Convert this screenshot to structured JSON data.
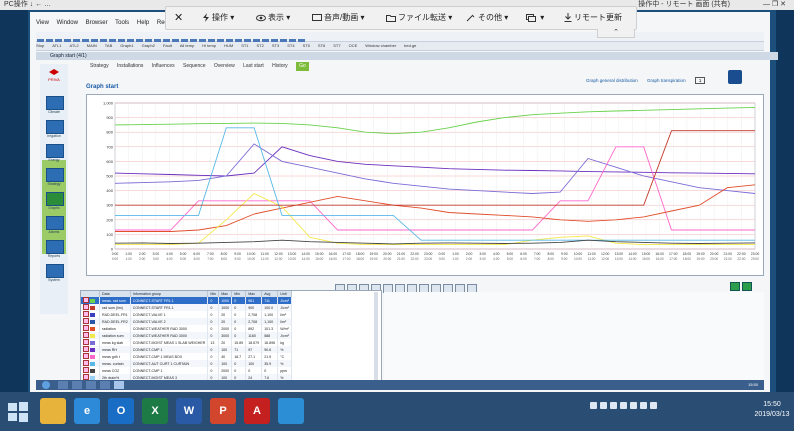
{
  "photo_top": {
    "left_text": "PC操作 ↓ ← …",
    "right_text": "操作中 - リモート 画面 (共有)",
    "right_text2": "— ❐ ✕"
  },
  "remote_toolbar": {
    "close": "✕",
    "items": [
      {
        "label": "操作",
        "icon": "lightning-icon"
      },
      {
        "label": "表示",
        "icon": "eye-icon"
      },
      {
        "label": "音声/動画",
        "icon": "chat-icon"
      },
      {
        "label": "ファイル転送",
        "icon": "folder-icon"
      },
      {
        "label": "その他",
        "icon": "tools-icon"
      },
      {
        "label": "",
        "icon": "windows-icon"
      },
      {
        "label": "リモート更新",
        "icon": "download-icon"
      }
    ],
    "collapse_label": "⌃"
  },
  "app_menu": [
    "View",
    "Window",
    "Browser",
    "Tools",
    "Help",
    "Registration"
  ],
  "toolbar2_items": [
    "Stop",
    "ATL1",
    "ATL2",
    "MAIN",
    "TAB",
    "Graph1",
    "Graph2",
    "Fault",
    "All temp",
    "Hl temp",
    "HUM",
    "ST1",
    "ST2",
    "ST3",
    "ST4",
    "ST5",
    "ST6",
    "ST7",
    "OCE",
    "Window chamber",
    "bed.ge"
  ],
  "app_title": "Graph start (4/1)",
  "nav_tabs": [
    "Strategy",
    "Installations",
    "Influences",
    "Sequence",
    "Overview",
    "Last start",
    "History"
  ],
  "nav_go": "Go",
  "sidebar": {
    "logo_text": "PRIVA",
    "items": [
      {
        "label": "Climate",
        "active": false
      },
      {
        "label": "Irrigation",
        "active": false
      },
      {
        "label": "Energy",
        "active": false
      },
      {
        "label": "Strategy",
        "active": false
      },
      {
        "label": "Graphs",
        "active": true
      },
      {
        "label": "Alarms",
        "active": false
      },
      {
        "label": "Reports",
        "active": false
      },
      {
        "label": "System",
        "active": false
      }
    ]
  },
  "graph": {
    "title": "Graph start",
    "links": [
      "Graph general distribution",
      "Graph transpiration"
    ],
    "period": "1"
  },
  "chart_data": {
    "type": "line",
    "title": "",
    "xlabel": "",
    "ylabel": "",
    "ylim": [
      0,
      1000
    ],
    "y_ticks": [
      "1,000",
      "900",
      "800",
      "700",
      "600",
      "500",
      "400",
      "300",
      "200",
      "100",
      "0"
    ],
    "x_ticks": [
      "0:00",
      "1:00",
      "2:00",
      "3:00",
      "4:00",
      "5:00",
      "6:00",
      "7:00",
      "8:00",
      "9:00",
      "10:00",
      "11:00",
      "12:00",
      "13:00",
      "14:00",
      "15:00",
      "16:00",
      "17:00",
      "18:00",
      "19:00",
      "20:00",
      "21:00",
      "22:00",
      "23:00",
      "0:00",
      "1:00",
      "2:00",
      "3:00",
      "4:00",
      "5:00",
      "6:00",
      "7:00",
      "8:00",
      "9:00",
      "10:00",
      "11:00",
      "12:00",
      "13:00",
      "14:00",
      "15:00",
      "16:00",
      "17:00",
      "18:00",
      "19:00",
      "20:00",
      "21:00",
      "22:00",
      "23:00"
    ],
    "grid": true,
    "series": [
      {
        "color": "#69d24a",
        "values": [
          850,
          852,
          855,
          858,
          860,
          862,
          860,
          850,
          830,
          800,
          790,
          800,
          830,
          870,
          900,
          920,
          930,
          940,
          945,
          950,
          955,
          960,
          965,
          970
        ]
      },
      {
        "color": "#6a2fbf",
        "values": [
          520,
          515,
          510,
          505,
          500,
          520,
          700,
          640,
          600,
          580,
          570,
          560,
          550,
          545,
          540,
          538,
          535,
          530,
          528,
          525,
          522,
          520,
          518,
          515
        ]
      },
      {
        "color": "#7b6bd6",
        "values": [
          450,
          455,
          460,
          470,
          500,
          720,
          600,
          560,
          520,
          480,
          450,
          430,
          410,
          400,
          390,
          380,
          390,
          620,
          560,
          500,
          460,
          420,
          400,
          380
        ]
      },
      {
        "color": "#ff66cc",
        "values": [
          130,
          130,
          130,
          330,
          330,
          330,
          330,
          330,
          130,
          130,
          130,
          130,
          130,
          130,
          130,
          130,
          330,
          330,
          700,
          700,
          130,
          130,
          130,
          130
        ]
      },
      {
        "color": "#e04e2a",
        "values": [
          120,
          120,
          120,
          130,
          160,
          240,
          280,
          320,
          360,
          330,
          300,
          280,
          250,
          240,
          230,
          220,
          200,
          190,
          200,
          220,
          260,
          300,
          420,
          440
        ]
      },
      {
        "color": "#f3e84a",
        "values": [
          30,
          30,
          30,
          40,
          200,
          380,
          290,
          80,
          40,
          30,
          30,
          30,
          30,
          30,
          30,
          60,
          80,
          90,
          40,
          30,
          30,
          30,
          30,
          30
        ]
      },
      {
        "color": "#57b8e6",
        "values": [
          230,
          230,
          230,
          230,
          830,
          830,
          230,
          230,
          230,
          230,
          230,
          60,
          60,
          60,
          60,
          60,
          60,
          60,
          60,
          60,
          60,
          60,
          60,
          60
        ]
      },
      {
        "color": "#c0392b",
        "values": [
          300,
          300,
          300,
          300,
          300,
          300,
          300,
          300,
          300,
          300,
          300,
          300,
          300,
          300,
          300,
          300,
          300,
          300,
          300,
          300,
          810,
          810,
          810,
          810
        ]
      },
      {
        "color": "#444444",
        "values": [
          40,
          42,
          38,
          40,
          45,
          50,
          60,
          50,
          45,
          40,
          35,
          40,
          42,
          40,
          38,
          40,
          45,
          60,
          50,
          45,
          40,
          38,
          40,
          42
        ]
      }
    ]
  },
  "table": {
    "columns": [
      "Data",
      "Information group",
      "Min",
      "Max",
      "Min",
      "Max",
      "Avg",
      "Unit"
    ],
    "rows": [
      {
        "color": "#69d24a",
        "data": "meas. rad sum",
        "group": "CONNECT-START FR1.1",
        "min": "0",
        "max": "1000",
        "min2": "0",
        "max2": "961",
        "avg": "711",
        "unit": "J/cm²",
        "selected": true
      },
      {
        "color": "#c0392b",
        "data": "rad sum (lim)",
        "group": "CONNECT-START FR1.1",
        "min": "0",
        "max": "1000",
        "min2": "0",
        "max2": "900",
        "avg": "100.0",
        "unit": "J/cm²",
        "selected": false
      },
      {
        "color": "#3a3fbf",
        "data": "RAD.DEEL.FR1",
        "group": "CONNECT-VALVE 1",
        "min": "0",
        "max": "20",
        "min2": "0",
        "max2": "2,708",
        "avg": "1,100",
        "unit": "l/m²",
        "selected": false
      },
      {
        "color": "#2a57a7",
        "data": "RAD.DEEL.FR2",
        "group": "CONNECT-VALVE 2",
        "min": "0",
        "max": "20",
        "min2": "0",
        "max2": "2,708",
        "avg": "1,100",
        "unit": "l/m²",
        "selected": false
      },
      {
        "color": "#e04e2a",
        "data": "radiation",
        "group": "CONNECT-WEATHER RAD 3000",
        "min": "0",
        "max": "2000",
        "min2": "0",
        "max2": "892",
        "avg": "101.3",
        "unit": "W/m²",
        "selected": false
      },
      {
        "color": "#f3e84a",
        "data": "radiation sum",
        "group": "CONNECT-WEATHER RAD 3000",
        "min": "0",
        "max": "3000",
        "min2": "0",
        "max2": "1160",
        "avg": "588",
        "unit": "J/cm²",
        "selected": false
      },
      {
        "color": "#7b6bd6",
        "data": "meas kg slab",
        "group": "CONNECT-MOIST MEAS 1 SLAB WEIGHER",
        "min": "13",
        "max": "20",
        "min2": "15.89",
        "max2": "18.679",
        "avg": "16.896",
        "unit": "kg",
        "selected": false
      },
      {
        "color": "#6a2fbf",
        "data": "meas RH",
        "group": "CONNECT-CMP 1",
        "min": "0",
        "max": "100",
        "min2": "71",
        "max2": "97",
        "avg": "90.6",
        "unit": "%",
        "selected": false
      },
      {
        "color": "#ff66cc",
        "data": "meas gdh t",
        "group": "CONNECT-CMP 1 MEAS BOX",
        "min": "0",
        "max": "40",
        "min2": "18.7",
        "max2": "27.1",
        "avg": "21.9",
        "unit": "°C",
        "selected": false
      },
      {
        "color": "#57b8e6",
        "data": "meas. curtain",
        "group": "CONNECT-AUT CURT 1 CURTAIN",
        "min": "0",
        "max": "100",
        "min2": "0",
        "max2": "100",
        "avg": "35.9",
        "unit": "%",
        "selected": false
      },
      {
        "color": "#444444",
        "data": "meas CO2",
        "group": "CONNECT-CMP 1",
        "min": "0",
        "max": "2000",
        "min2": "0",
        "max2": "0",
        "avg": "0",
        "unit": "ppm",
        "selected": false
      },
      {
        "color": "#9ad0f5",
        "data": "2th drain%",
        "group": "CONNECT-MOIST MEAS 3",
        "min": "0",
        "max": "100",
        "min2": "0",
        "max2": "24",
        "avg": "7.6",
        "unit": "%",
        "selected": false
      },
      {
        "color": "#3fbf6f",
        "data": "cycle drain%",
        "group": "CONNECT-MOIST MEAS 1",
        "min": "0",
        "max": "100",
        "min2": "0",
        "max2": "182",
        "avg": "25.4",
        "unit": "%",
        "selected": false
      },
      {
        "color": "#bdbd3a",
        "data": "vent position",
        "group": "CONNECT-VENT 1",
        "min": "0",
        "max": "100",
        "min2": "0",
        "max2": "40",
        "avg": "6.1",
        "unit": "%",
        "selected": false
      }
    ]
  },
  "taskbar": {
    "apps": [
      {
        "name": "file-explorer",
        "glyph": "",
        "color": "#e8b33b"
      },
      {
        "name": "internet-explorer",
        "glyph": "e",
        "color": "#2d8ad9"
      },
      {
        "name": "outlook",
        "glyph": "O",
        "color": "#1a6dc4"
      },
      {
        "name": "excel",
        "glyph": "X",
        "color": "#1e7a45"
      },
      {
        "name": "word",
        "glyph": "W",
        "color": "#2a5aa6"
      },
      {
        "name": "powerpoint",
        "glyph": "P",
        "color": "#d2462e"
      },
      {
        "name": "acrobat",
        "glyph": "A",
        "color": "#c52020"
      },
      {
        "name": "remote-app",
        "glyph": "",
        "color": "#2c8fd6"
      }
    ],
    "time": "15:50",
    "date": "2019/03/13"
  },
  "inner_taskbar_time": "15:50"
}
